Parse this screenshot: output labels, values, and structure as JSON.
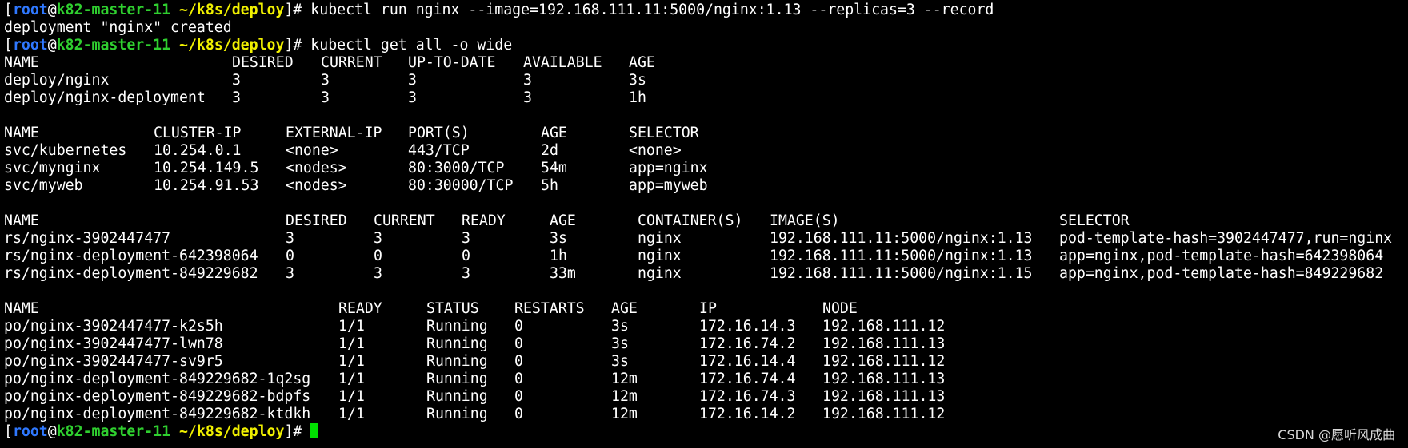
{
  "prompt": {
    "user": "root",
    "host": "k82-master-11",
    "path": "~/k8s/deploy",
    "symbol": "#"
  },
  "commands": {
    "run": " kubectl run nginx --image=192.168.111.11:5000/nginx:1.13 --replicas=3 --record",
    "run_output": "deployment \"nginx\" created",
    "get_all": " kubectl get all -o wide"
  },
  "deployments": {
    "headers": [
      "NAME",
      "DESIRED",
      "CURRENT",
      "UP-TO-DATE",
      "AVAILABLE",
      "AGE"
    ],
    "rows": [
      [
        "deploy/nginx",
        "3",
        "3",
        "3",
        "3",
        "3s"
      ],
      [
        "deploy/nginx-deployment",
        "3",
        "3",
        "3",
        "3",
        "1h"
      ]
    ]
  },
  "services": {
    "headers": [
      "NAME",
      "CLUSTER-IP",
      "EXTERNAL-IP",
      "PORT(S)",
      "AGE",
      "SELECTOR"
    ],
    "rows": [
      [
        "svc/kubernetes",
        "10.254.0.1",
        "<none>",
        "443/TCP",
        "2d",
        "<none>"
      ],
      [
        "svc/mynginx",
        "10.254.149.5",
        "<nodes>",
        "80:3000/TCP",
        "54m",
        "app=nginx"
      ],
      [
        "svc/myweb",
        "10.254.91.53",
        "<nodes>",
        "80:30000/TCP",
        "5h",
        "app=myweb"
      ]
    ]
  },
  "replicasets": {
    "headers": [
      "NAME",
      "DESIRED",
      "CURRENT",
      "READY",
      "AGE",
      "CONTAINER(S)",
      "IMAGE(S)",
      "SELECTOR"
    ],
    "rows": [
      [
        "rs/nginx-3902447477",
        "3",
        "3",
        "3",
        "3s",
        "nginx",
        "192.168.111.11:5000/nginx:1.13",
        "pod-template-hash=3902447477,run=nginx"
      ],
      [
        "rs/nginx-deployment-642398064",
        "0",
        "0",
        "0",
        "1h",
        "nginx",
        "192.168.111.11:5000/nginx:1.13",
        "app=nginx,pod-template-hash=642398064"
      ],
      [
        "rs/nginx-deployment-849229682",
        "3",
        "3",
        "3",
        "33m",
        "nginx",
        "192.168.111.11:5000/nginx:1.15",
        "app=nginx,pod-template-hash=849229682"
      ]
    ]
  },
  "pods": {
    "headers": [
      "NAME",
      "READY",
      "STATUS",
      "RESTARTS",
      "AGE",
      "IP",
      "NODE"
    ],
    "rows": [
      [
        "po/nginx-3902447477-k2s5h",
        "1/1",
        "Running",
        "0",
        "3s",
        "172.16.14.3",
        "192.168.111.12"
      ],
      [
        "po/nginx-3902447477-lwn78",
        "1/1",
        "Running",
        "0",
        "3s",
        "172.16.74.2",
        "192.168.111.13"
      ],
      [
        "po/nginx-3902447477-sv9r5",
        "1/1",
        "Running",
        "0",
        "3s",
        "172.16.14.4",
        "192.168.111.12"
      ],
      [
        "po/nginx-deployment-849229682-1q2sg",
        "1/1",
        "Running",
        "0",
        "12m",
        "172.16.74.4",
        "192.168.111.13"
      ],
      [
        "po/nginx-deployment-849229682-bdpfs",
        "1/1",
        "Running",
        "0",
        "12m",
        "172.16.74.3",
        "192.168.111.13"
      ],
      [
        "po/nginx-deployment-849229682-ktdkh",
        "1/1",
        "Running",
        "0",
        "12m",
        "172.16.14.2",
        "192.168.111.12"
      ]
    ]
  },
  "watermark": "CSDN @愿听风成曲",
  "colors": {
    "background": "#000000",
    "text": "#ffffff",
    "user": "#2f78ff",
    "host": "#2fcf2f",
    "path": "#f0f000",
    "cursor": "#00e000"
  }
}
